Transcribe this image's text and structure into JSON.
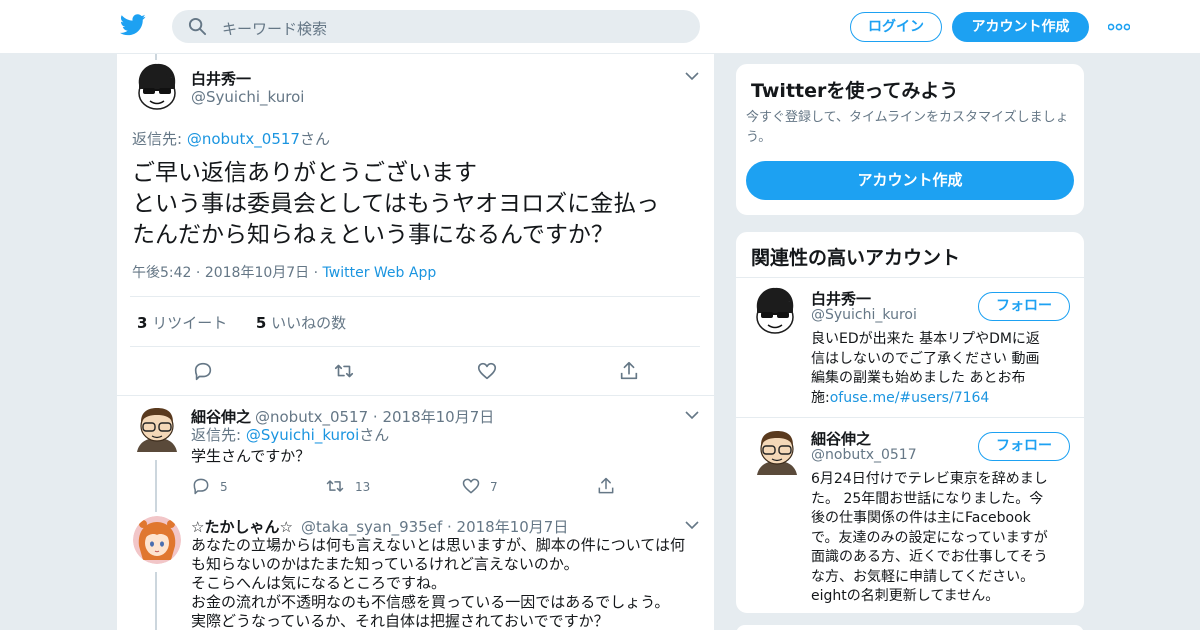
{
  "colors": {
    "accent": "#1da1f2",
    "link": "#1b95e0",
    "muted": "#657786",
    "background": "#e6ecf0"
  },
  "nav": {
    "logo": "twitter-bird-icon",
    "search_placeholder": "キーワード検索",
    "login_label": "ログイン",
    "signup_label": "アカウント作成",
    "more": "more-dots-icon"
  },
  "main_tweet": {
    "name": "白井秀一",
    "handle": "@Syuichi_kuroi",
    "replying_label": "返信先: ",
    "replying_to": "@nobutx_0517",
    "replying_suffix": "さん",
    "text_lines": [
      "ご早い返信ありがとうございます",
      "という事は委員会としてはもうヤオヨロズに金払っ",
      "たんだから知らねぇという事になるんですか？"
    ],
    "time": "午後5:42",
    "date": "2018年10月7日",
    "source": "Twitter Web App",
    "retweets": "3",
    "retweets_label": "リツイート",
    "likes": "5",
    "likes_label": "いいねの数"
  },
  "replies": [
    {
      "name": "細谷伸之",
      "handle": "@nobutx_0517",
      "date": "2018年10月7日",
      "replying_label": "返信先: ",
      "replying_to": "@Syuichi_kuroi",
      "replying_suffix": "さん",
      "text": "学生さんですか？",
      "replies_count": "5",
      "retweets_count": "13",
      "likes_count": "7"
    },
    {
      "name": "☆たかしゃん☆",
      "handle": "@taka_syan_935ef",
      "date": "2018年10月7日",
      "text_lines": [
        "あなたの立場からは何も言えないとは思いますが、脚本の件については何",
        "も知らないのかはたまた知っているけれど言えないのか。",
        "そこらへんは気になるところですね。",
        "お金の流れが不透明なのも不信感を買っている一因ではあるでしょう。",
        "実際どうなっているか、それ自体は把握されておいでですか？"
      ]
    }
  ],
  "sidebar": {
    "signup_card": {
      "title": "Twitterを使ってみよう",
      "subtitle": "今すぐ登録して、タイムラインをカスタマイズしましょう。",
      "button": "アカウント作成"
    },
    "related_card": {
      "title": "関連性の高いアカウント",
      "follow_label": "フォロー",
      "accounts": [
        {
          "name": "白井秀一",
          "handle": "@Syuichi_kuroi",
          "bio_lines": [
            "良いEDが出来た 基本リプやDMに返",
            "信はしないのでご了承ください 動画",
            "編集の副業も始めました あとお布"
          ],
          "bio_last_prefix": "施:",
          "bio_link": "ofuse.me/#users/7164"
        },
        {
          "name": "細谷伸之",
          "handle": "@nobutx_0517",
          "bio_lines": [
            "6月24日付けでテレビ東京を辞めまし",
            "た。 25年間お世話になりました。今",
            "後の仕事関係の件は主にFacebook",
            "で。友達のみの設定になっていますが",
            "面識のある方、近くでお仕事してそう",
            "な方、お気軽に申請してください。",
            "eightの名刺更新してません。"
          ]
        }
      ]
    }
  }
}
